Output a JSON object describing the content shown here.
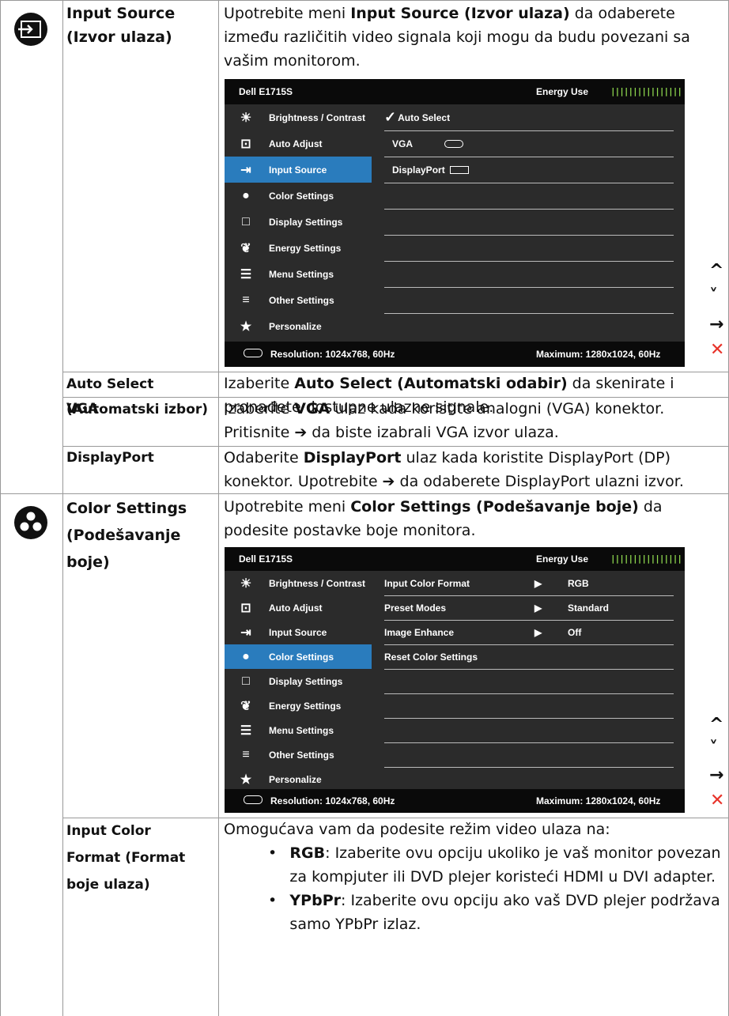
{
  "section_input": {
    "label": "Input Source (Izvor ulaza)",
    "desc_pre": "Upotrebite meni ",
    "desc_bold": "Input Source (Izvor ulaza)",
    "desc_post": " da odaberete između različitih video signala koji mogu da budu povezani sa vašim monitorom.",
    "osd": {
      "model": "Dell E1715S",
      "energy_label": "Energy Use",
      "energy_bar": "||||||||||||||||",
      "menu": [
        "Brightness / Contrast",
        "Auto Adjust",
        "Input Source",
        "Color Settings",
        "Display Settings",
        "Energy Settings",
        "Menu Settings",
        "Other Settings",
        "Personalize"
      ],
      "selected": 2,
      "options": [
        "Auto Select",
        "VGA",
        "DisplayPort"
      ],
      "resolution": "Resolution: 1024x768, 60Hz",
      "maximum": "Maximum: 1280x1024, 60Hz"
    },
    "sub": [
      {
        "label": "Auto Select (Automatski izbor)",
        "pre": "Izaberite ",
        "bold": "Auto Select (Automatski odabir)",
        "post": " da skenirate i pronađete dostupne ulazne signale."
      },
      {
        "label": "VGA",
        "pre": "Izaberite ",
        "bold": "VGA",
        "post": " ulaz kada koristite analogni (VGA) konektor. Pritisnite ➔ da biste izabrali VGA izvor ulaza."
      },
      {
        "label": "DisplayPort",
        "pre": "Odaberite ",
        "bold": "DisplayPort",
        "post": " ulaz kada koristite DisplayPort (DP) konektor. Upotrebite ➔ da odaberete DisplayPort ulazni izvor."
      }
    ]
  },
  "section_color": {
    "label": "Color Settings (Podešavanje boje)",
    "desc_pre": "Upotrebite meni ",
    "desc_bold": "Color Settings (Podešavanje boje)",
    "desc_post": " da podesite postavke boje monitora.",
    "osd": {
      "model": "Dell E1715S",
      "energy_label": "Energy Use",
      "energy_bar": "||||||||||||||||",
      "selected": 3,
      "rows": [
        {
          "name": "Input Color Format",
          "value": "RGB"
        },
        {
          "name": "Preset Modes",
          "value": "Standard"
        },
        {
          "name": "Image Enhance",
          "value": "Off"
        },
        {
          "name": "Reset Color Settings",
          "value": ""
        }
      ],
      "resolution": "Resolution: 1024x768, 60Hz",
      "maximum": "Maximum: 1280x1024, 60Hz"
    },
    "sub": {
      "label": "Input Color Format (Format boje ulaza)",
      "intro": "Omogućava vam da podesite režim video ulaza na:",
      "bullets": [
        {
          "bold": "RGB",
          "text": ": Izaberite ovu opciju ukoliko je vaš monitor povezan za kompjuter ili DVD plejer koristeći HDMI u DVI adapter."
        },
        {
          "bold": "YPbPr",
          "text": ": Izaberite ovu opciju ako vaš DVD plejer podržava samo YPbPr izlaz."
        }
      ]
    }
  },
  "nav_icons": [
    "up-icon",
    "down-icon",
    "right-arrow-icon",
    "close-icon"
  ]
}
